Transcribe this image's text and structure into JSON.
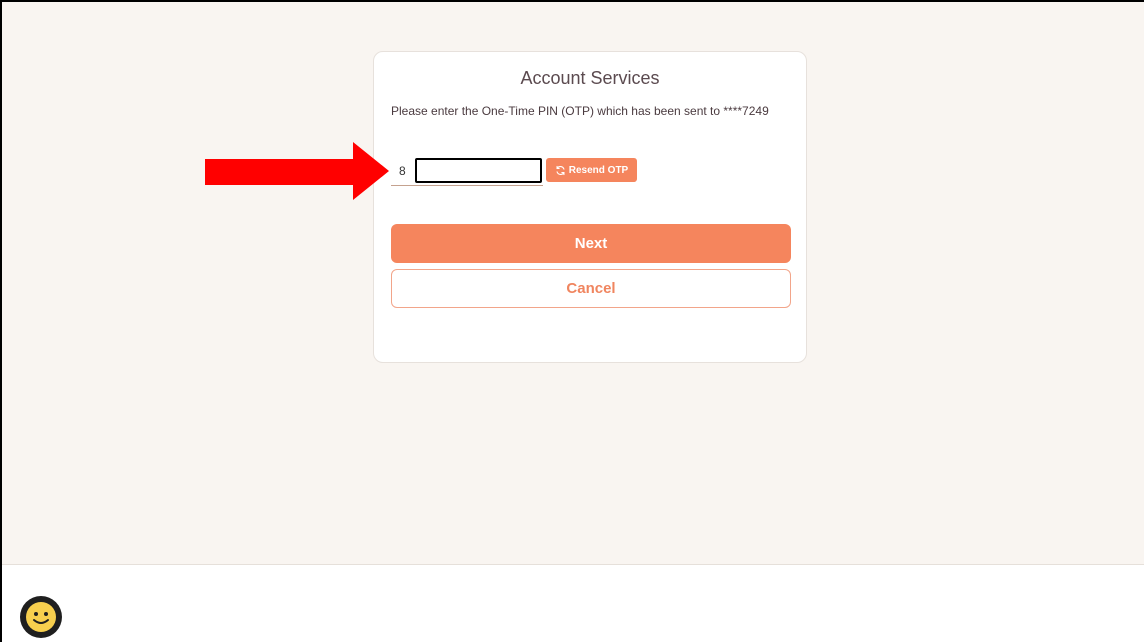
{
  "card": {
    "title": "Account Services",
    "instruction": "Please enter the One-Time PIN (OTP) which has been sent to ****7249"
  },
  "otp": {
    "visible_value": "8"
  },
  "buttons": {
    "resend": "Resend OTP",
    "next": "Next",
    "cancel": "Cancel"
  },
  "colors": {
    "accent": "#f5855d",
    "background": "#f9f5f1",
    "annotation_arrow": "#ff0000"
  },
  "icons": {
    "resend": "refresh-icon",
    "chat": "smiley-face-icon",
    "annotation": "red-arrow-icon"
  }
}
